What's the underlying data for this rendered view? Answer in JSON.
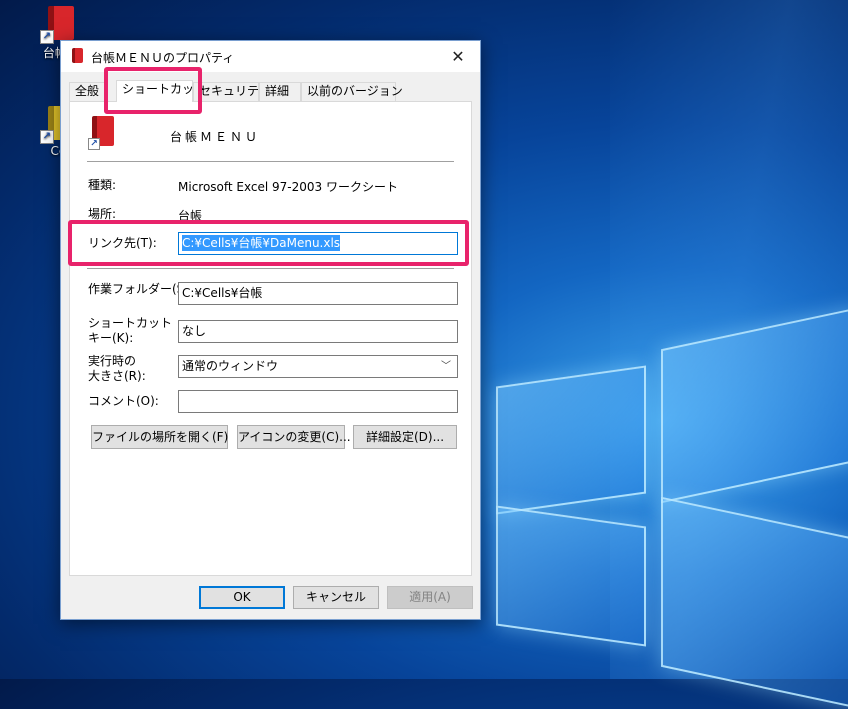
{
  "desktop": {
    "icons": [
      {
        "label": "台帳M",
        "color": "red"
      },
      {
        "label": "Cel",
        "color": "yellow"
      }
    ]
  },
  "dialog": {
    "title": "台帳ＭＥＮＵのプロパティ",
    "close_glyph": "✕",
    "tabs": [
      "全般",
      "ショートカット",
      "セキュリティ",
      "詳細",
      "以前のバージョン"
    ],
    "active_tab": "ショートカット",
    "file_name": "台帳ＭＥＮＵ",
    "type_label": "種類:",
    "type_value": "Microsoft Excel 97-2003 ワークシート",
    "location_label": "場所:",
    "location_value": "台帳",
    "target_label": "リンク先(T):",
    "target_value": "C:¥Cells¥台帳¥DaMenu.xls",
    "workdir_label": "作業フォルダー(S):",
    "workdir_value": "C:¥Cells¥台帳",
    "shortcut_label_1": "ショートカット",
    "shortcut_label_2": "キー(K):",
    "shortcut_value": "なし",
    "run_label_1": "実行時の",
    "run_label_2": "大きさ(R):",
    "run_value": "通常のウィンドウ",
    "comment_label": "コメント(O):",
    "comment_value": "",
    "buttons": {
      "open_location": "ファイルの場所を開く(F)",
      "change_icon": "アイコンの変更(C)...",
      "advanced": "詳細設定(D)..."
    },
    "footer": {
      "ok": "OK",
      "cancel": "キャンセル",
      "apply": "適用(A)"
    }
  },
  "colors": {
    "highlight": "#e8236b",
    "selection": "#3399ff",
    "accent": "#0078d7"
  }
}
